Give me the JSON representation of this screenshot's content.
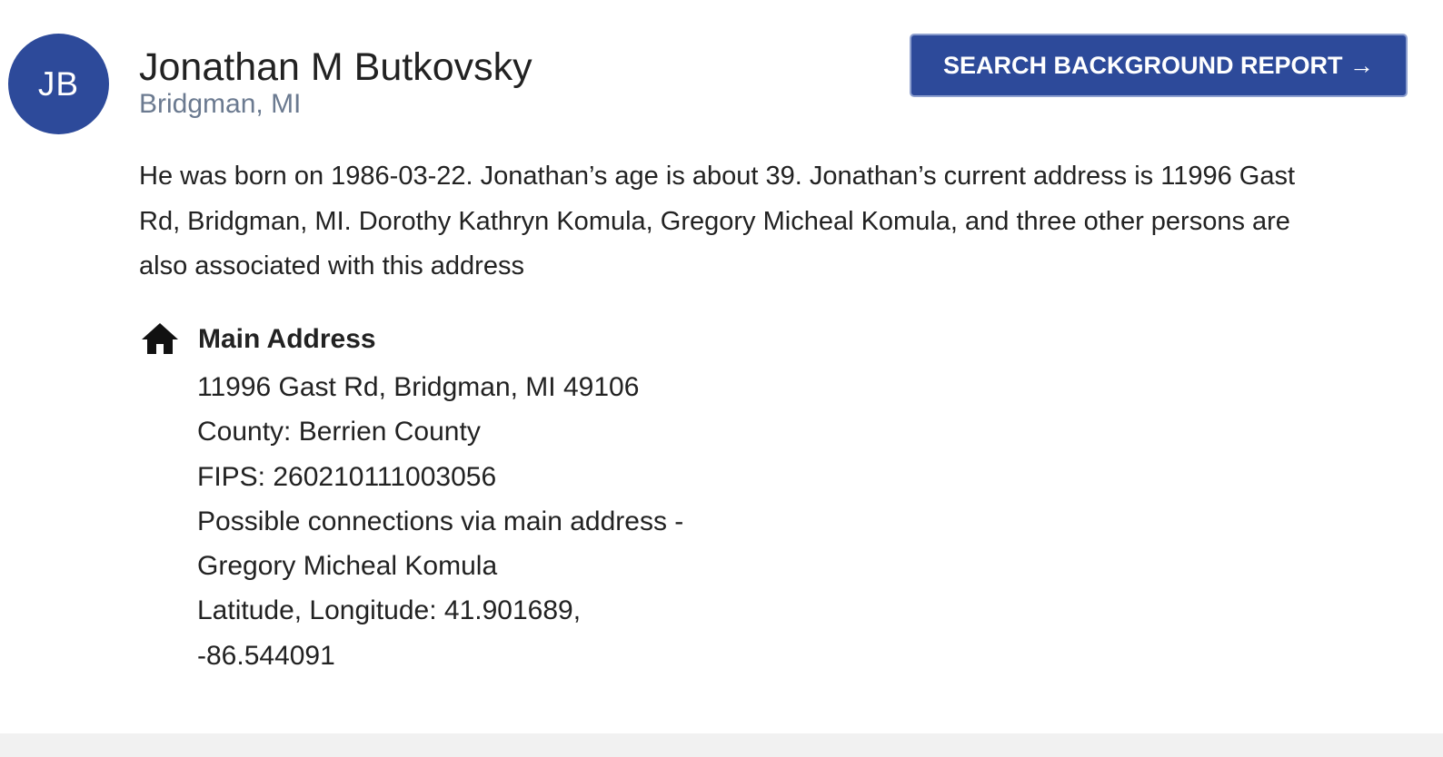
{
  "profile": {
    "initials": "JB",
    "name": "Jonathan M Butkovsky",
    "location": "Bridgman, MI",
    "cta_label": "SEARCH BACKGROUND REPORT →"
  },
  "summary": {
    "line1": "He was born on 1986-03-22. Jonathan’s age is about 39. Jonathan’s current address is 11996 Gast",
    "line2": "Rd, Bridgman, MI. Dorothy Kathryn Komula, Gregory Micheal Komula, and three other persons are",
    "line3": "also associated with this address"
  },
  "main_address": {
    "icon": "home-icon",
    "title": "Main Address",
    "street": "11996 Gast Rd, Bridgman, MI 49106",
    "county": "County: Berrien County",
    "fips": "FIPS: 260210111003056",
    "connections_label": "Possible connections via main address -",
    "connection_name": "Gregory Micheal Komula",
    "latlong_label": "Latitude, Longitude: 41.901689,",
    "longitude": "-86.544091"
  },
  "colors": {
    "brand": "#2d4a9a",
    "location_text": "#6b7a90",
    "footer": "#f1f1f1"
  }
}
